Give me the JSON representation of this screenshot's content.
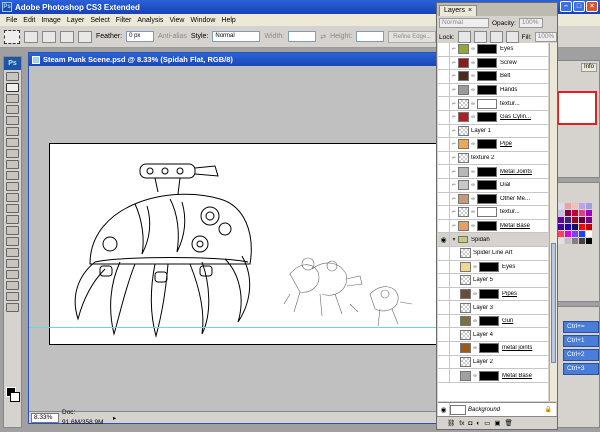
{
  "window": {
    "title": "Adobe Photoshop CS3 Extended",
    "logo": "Ps"
  },
  "menu": [
    "File",
    "Edit",
    "Image",
    "Layer",
    "Select",
    "Filter",
    "Analysis",
    "View",
    "Window",
    "Help"
  ],
  "options": {
    "feather_label": "Feather:",
    "feather_value": "0 px",
    "antialias_label": "Anti-alias",
    "style_label": "Style:",
    "style_value": "Normal",
    "width_label": "Width:",
    "height_label": "Height:",
    "refine_label": "Refine Edge..."
  },
  "document": {
    "title": "Steam Punk Scene.psd @ 8.33% (Spidah Flat, RGB/8)",
    "zoom": "8.33%",
    "doc_info": "Doc: 91.6M/358.9M"
  },
  "layers_panel": {
    "tab_label": "Layers",
    "close_glyph": "×",
    "blend_mode": "Normal",
    "opacity_label": "Opacity:",
    "opacity_value": "100%",
    "lock_label": "Lock:",
    "fill_label": "Fill:",
    "fill_value": "100%",
    "group_label": "Spidah",
    "background_layer": "Background",
    "info_tab": "Info"
  },
  "layers_upper": [
    {
      "name": "Eyes",
      "color": "#8ea83a",
      "mask": "dark",
      "underline": false
    },
    {
      "name": "Screw",
      "color": "#8a1a1a",
      "mask": "dark",
      "underline": false
    },
    {
      "name": "Belt",
      "color": "#4a2a1a",
      "mask": "dark",
      "underline": false
    },
    {
      "name": "Hands",
      "color": "#9a9a9a",
      "mask": "dark",
      "underline": false
    },
    {
      "name": "textur...",
      "color": "checker",
      "mask": "light",
      "underline": false
    },
    {
      "name": "Gas Cylin...",
      "color": "#b02020",
      "mask": "dark",
      "underline": true
    },
    {
      "name": "Layer 1",
      "color": "checker",
      "mask": "none",
      "underline": false
    },
    {
      "name": "Pipe",
      "color": "#f0a84a",
      "mask": "dark",
      "underline": true
    },
    {
      "name": "texture 2",
      "color": "checker",
      "mask": "none",
      "underline": false
    },
    {
      "name": "Metal Joints",
      "color": "#b8b8b8",
      "mask": "dark",
      "underline": true
    },
    {
      "name": "Dial",
      "color": "#c8c8c8",
      "mask": "dark",
      "underline": false
    },
    {
      "name": "Other Me...",
      "color": "#c49a7a",
      "mask": "dark",
      "underline": false
    },
    {
      "name": "textur...",
      "color": "checker",
      "mask": "light",
      "underline": false
    },
    {
      "name": "Metal Base",
      "color": "#e8a060",
      "mask": "dark",
      "underline": true
    }
  ],
  "layers_group": [
    {
      "name": "Spider Line Art",
      "color": "checker",
      "mask": "none",
      "underline": false
    },
    {
      "name": "Eyes",
      "color": "#f0d890",
      "mask": "dark",
      "underline": false
    },
    {
      "name": "Layer 5",
      "color": "checker",
      "mask": "none",
      "underline": false
    },
    {
      "name": "Pipes",
      "color": "#6a4a3a",
      "mask": "dark",
      "underline": true
    },
    {
      "name": "Layer 3",
      "color": "checker",
      "mask": "none",
      "underline": false
    },
    {
      "name": "Gun",
      "color": "#7a7040",
      "mask": "dark",
      "underline": true
    },
    {
      "name": "Layer 4",
      "color": "checker",
      "mask": "none",
      "underline": false
    },
    {
      "name": "metal joints",
      "color": "#9a5a1a",
      "mask": "dark",
      "underline": true
    },
    {
      "name": "Layer 2",
      "color": "checker",
      "mask": "none",
      "underline": false
    },
    {
      "name": "Metal Base",
      "color": "#a0a0a0",
      "mask": "dark",
      "underline": true
    }
  ],
  "actions": [
    {
      "label": "Ctrl+="
    },
    {
      "label": "Ctrl+1"
    },
    {
      "label": "Ctrl+2"
    },
    {
      "label": "Ctrl+3"
    }
  ],
  "layers_bottom_icons": [
    "link-icon",
    "fx-icon",
    "mask-icon",
    "adjustment-icon",
    "folder-icon",
    "new-layer-icon",
    "trash-icon"
  ],
  "colors": {
    "title_blue": "#2b62d9",
    "chrome": "#d6d3ce",
    "guide_cyan": "#6fd5e6"
  }
}
